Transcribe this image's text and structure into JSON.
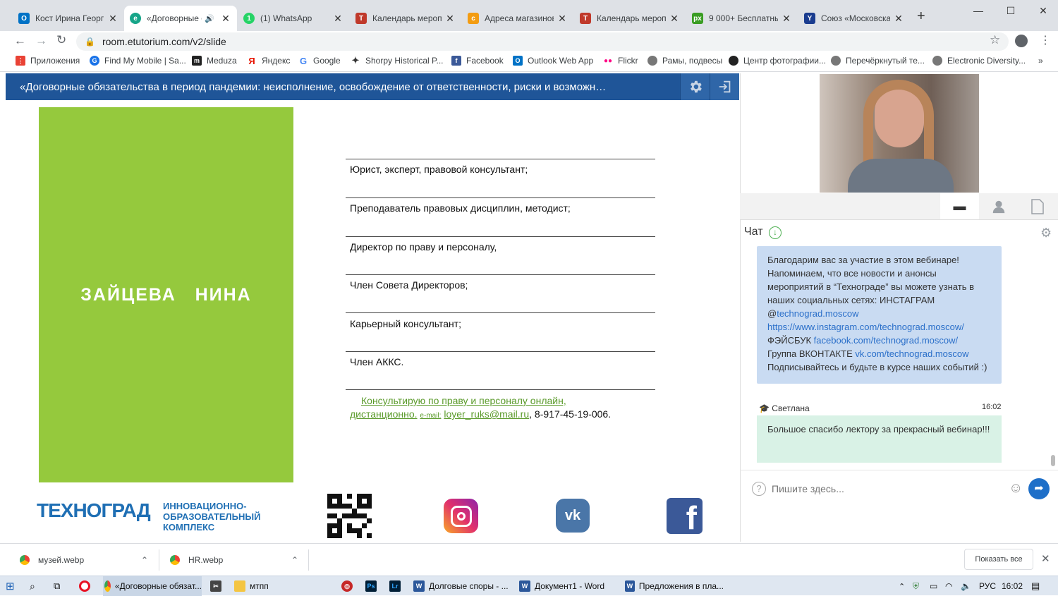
{
  "tabs": [
    {
      "title": "Кост Ирина Георги",
      "icon": "outlook-icon",
      "color": "#0072c6"
    },
    {
      "title": "«Договорные о",
      "icon": "etutorium-icon",
      "color": "#17a589",
      "active": true
    },
    {
      "title": "(1) WhatsApp",
      "icon": "whatsapp-icon",
      "color": "#25d366"
    },
    {
      "title": "Календарь меропр",
      "icon": "calendar-icon",
      "color": "#c0392b"
    },
    {
      "title": "Адреса магазинов",
      "icon": "shop-icon",
      "color": "#f39c12"
    },
    {
      "title": "Календарь меропр",
      "icon": "calendar-icon",
      "color": "#c0392b"
    },
    {
      "title": "9 000+ Бесплатные",
      "icon": "px-icon",
      "color": "#3a9d23"
    },
    {
      "title": "Союз «Московска",
      "icon": "union-icon",
      "color": "#1a3c8f"
    }
  ],
  "new_tab": "+",
  "address": "room.etutorium.com/v2/slide",
  "bookmarks": [
    {
      "label": "Приложения",
      "color": "#e94235"
    },
    {
      "label": "Find My Mobile | Sa...",
      "color": "#1a73e8"
    },
    {
      "label": "Meduza",
      "color": "#222"
    },
    {
      "label": "Яндекс",
      "color": "#e61400"
    },
    {
      "label": "Google",
      "color": "#4285f4"
    },
    {
      "label": "Shorpy Historical P...",
      "color": "#333"
    },
    {
      "label": "Facebook",
      "color": "#3b5998"
    },
    {
      "label": "Outlook Web App",
      "color": "#0072c6"
    },
    {
      "label": "Flickr",
      "color": "#ff0084"
    },
    {
      "label": "Рамы, подвесы",
      "color": "#555"
    },
    {
      "label": "Центр фотографии...",
      "color": "#222"
    },
    {
      "label": "Перечёркнутый те...",
      "color": "#555"
    },
    {
      "label": "Electronic Diversity...",
      "color": "#555"
    }
  ],
  "bookmarks_more": "»",
  "slide": {
    "title": "«Договорные обязательства в период пандемии: неисполнение, освобождение от ответственности, риски и возможн…",
    "speaker_name": "ЗАЙЦЕВА   НИНА",
    "roles": [
      "Юрист, эксперт, правовой консультант;",
      "Преподаватель правовых дисциплин, методист;",
      "Директор по праву и персоналу,",
      "Член Совета Директоров;",
      "Карьерный консультант;",
      "Член АККС."
    ],
    "consult_line1": "Консультирую по праву и персоналу онлайн,",
    "consult_line2": "дистанционно.",
    "consult_email_label": "e-mail:",
    "consult_email": "loyer_ruks@mail.ru",
    "consult_phone": ", 8-917-45-19-006.",
    "logo_name": "ТЕХНОГРАД",
    "logo_text": [
      "ИННОВАЦИОННО-",
      "ОБРАЗОВАТЕЛЬНЫЙ",
      "КОМПЛЕКС"
    ]
  },
  "chat": {
    "label": "Чат",
    "message1": {
      "text1": "Благодарим вас за участие в этом вебинаре! Напоминаем, что все новости и анонсы мероприятий в “Технограде” вы можете узнать в наших социальных сетях: ИНСТАГРАМ @",
      "link1": "technograd.moscow",
      "link2": "https://www.instagram.com/technograd.moscow/",
      "text2": "ФЭЙСБУК ",
      "link3": "facebook.com/technograd.moscow/",
      "text3": "Группа ВКОНТАКТЕ ",
      "link4": "vk.com/technograd.moscow",
      "text4": "Подписывайтесь и будьте в курсе наших событий :)"
    },
    "message2": {
      "author": "Светлана",
      "time": "16:02",
      "text": "Большое спасибо лектору за прекрасный вебинар!!!"
    },
    "input_placeholder": "Пишите здесь..."
  },
  "downloads": {
    "items": [
      "музей.webp",
      "HR.webp"
    ],
    "show_all": "Показать все"
  },
  "taskbar": {
    "apps": [
      {
        "label": "«Договорные обязат...",
        "color": "#4285f4"
      },
      {
        "label": "мтпп",
        "color": "#f4c542"
      },
      {
        "label": "Долговые споры - ...",
        "color": "#2b579a"
      },
      {
        "label": "Документ1 - Word",
        "color": "#2b579a"
      },
      {
        "label": "Предложения в пла...",
        "color": "#2b579a"
      }
    ],
    "lang": "РУС",
    "time": "16:02"
  }
}
